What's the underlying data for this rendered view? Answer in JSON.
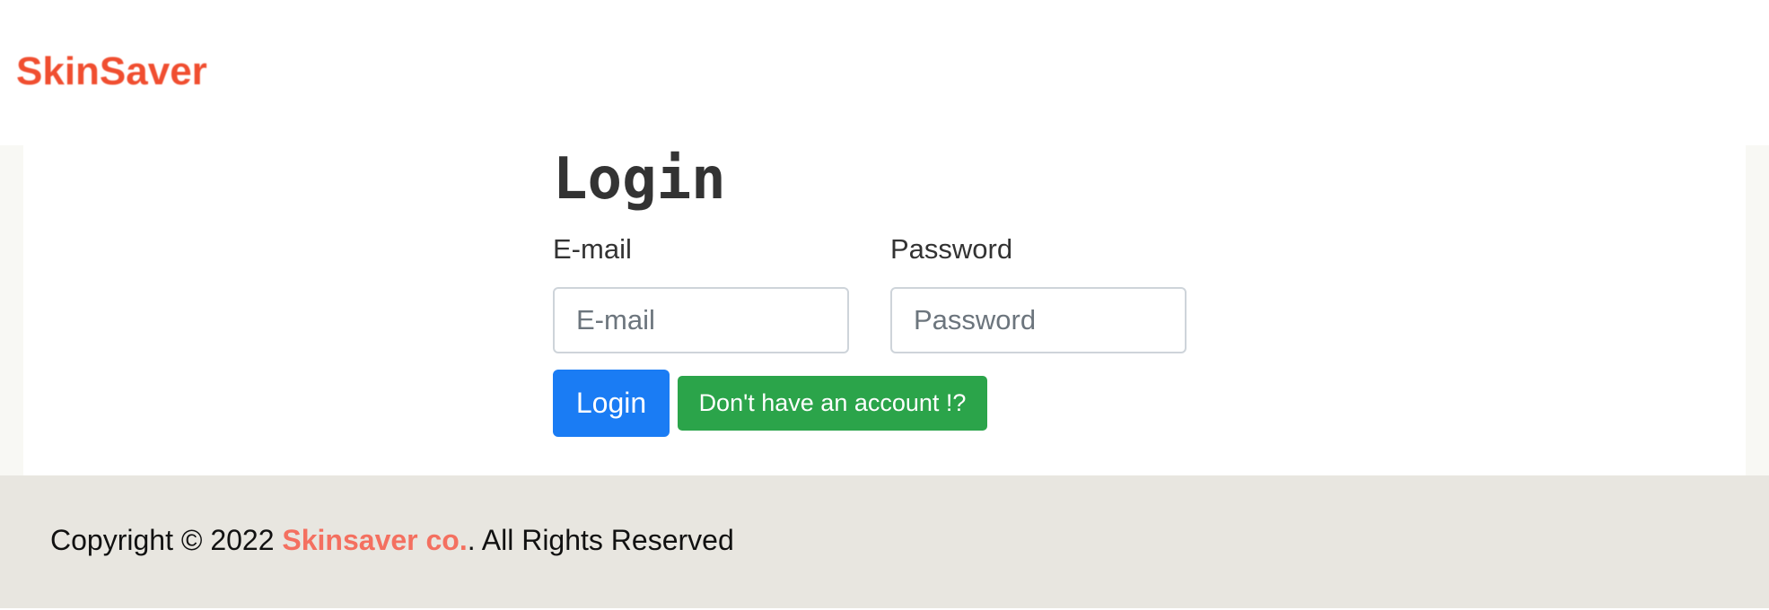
{
  "navbar": {
    "brand": "SkinSaver",
    "brand_color": "#f04e30"
  },
  "login": {
    "title": "Login",
    "email_label": "E-mail",
    "email_placeholder": "E-mail",
    "email_value": "",
    "password_label": "Password",
    "password_placeholder": "Password",
    "password_value": "",
    "submit_label": "Login",
    "register_label": "Don't have an account !?"
  },
  "footer": {
    "prefix": "Copyright © 2022 ",
    "company": "Skinsaver co.",
    "suffix": ". All Rights Reserved"
  },
  "colors": {
    "primary_button": "#1a7cf4",
    "success_button": "#2ba44a",
    "footer_bg": "#e8e6e0",
    "footer_brand": "#f47060"
  }
}
